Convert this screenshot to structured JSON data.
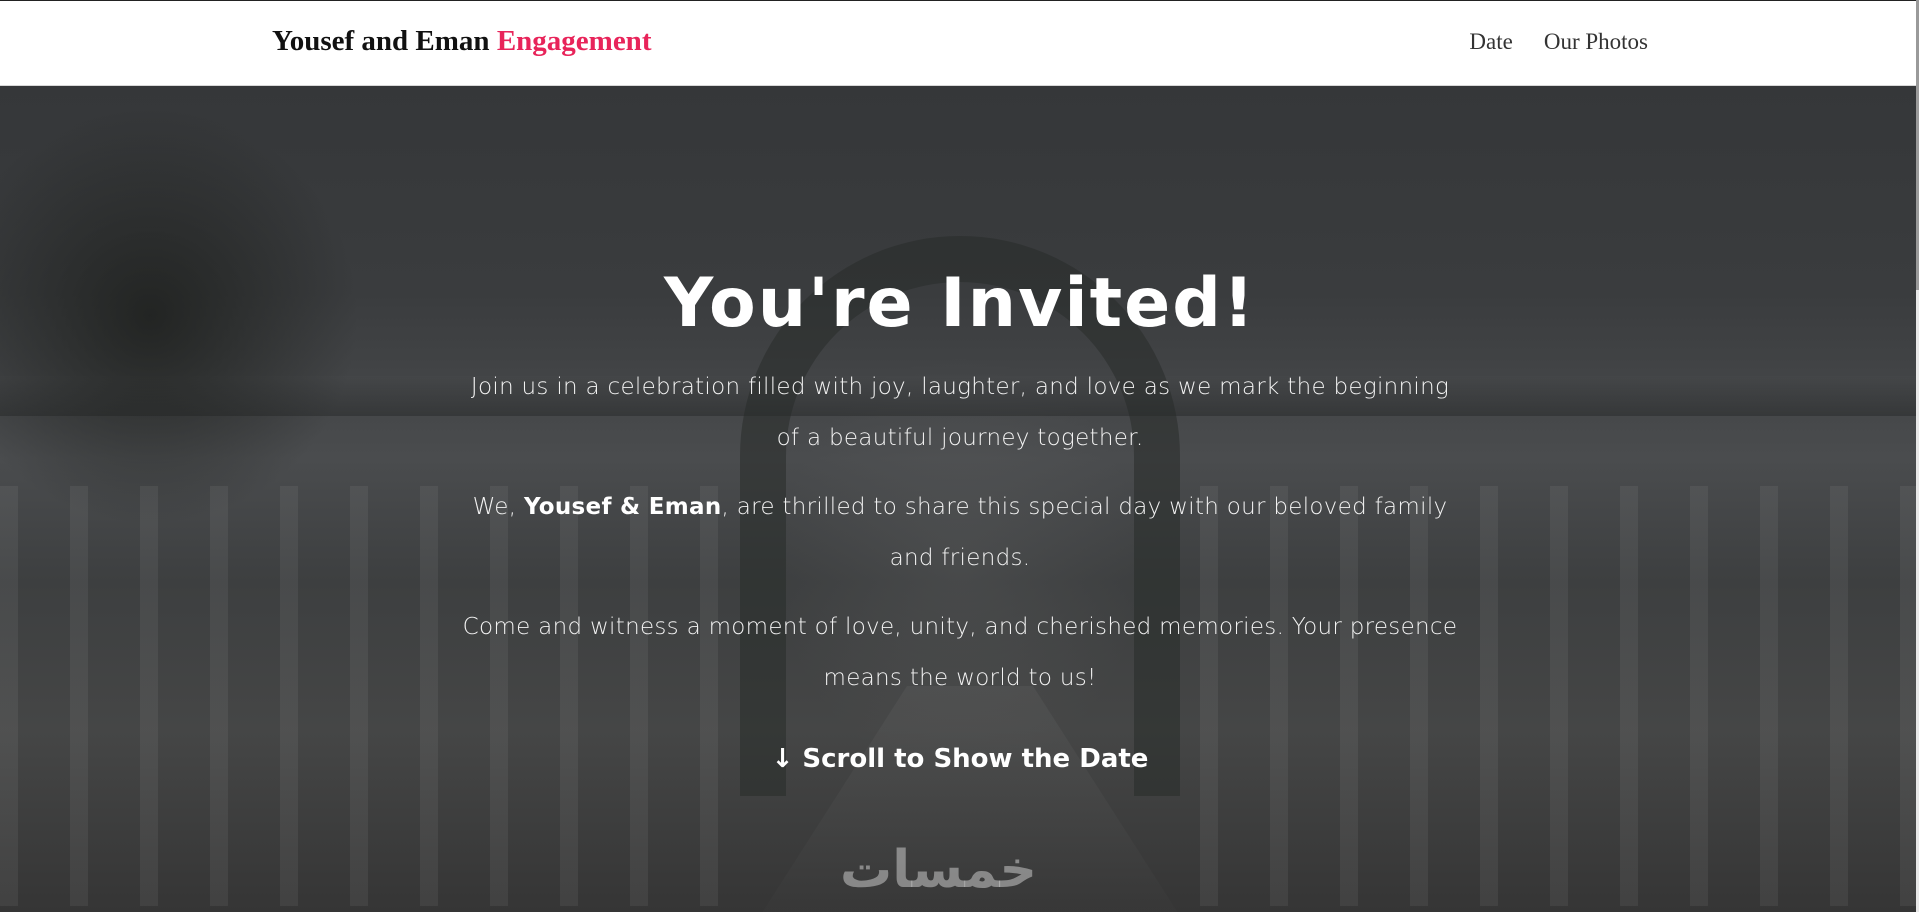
{
  "navbar": {
    "brand_main": "Yousef and Eman",
    "brand_accent": "Engagement",
    "links": [
      "Date",
      "Our Photos"
    ]
  },
  "hero": {
    "title": "You're Invited!",
    "paragraph1": "Join us in a celebration filled with joy, laughter, and love as we mark the beginning of a beautiful journey together.",
    "paragraph2_prefix": "We, ",
    "paragraph2_names": "Yousef & Eman",
    "paragraph2_suffix": ", are thrilled to share this special day with our beloved family and friends.",
    "paragraph3": "Come and witness a moment of love, unity, and cherished memories. Your presence means the world to us!",
    "scroll_link": "↓ Scroll to Show the Date"
  },
  "watermark": {
    "text": "خمسات"
  },
  "colors": {
    "accent": "#e8245a",
    "nav_background": "#ffffff"
  }
}
